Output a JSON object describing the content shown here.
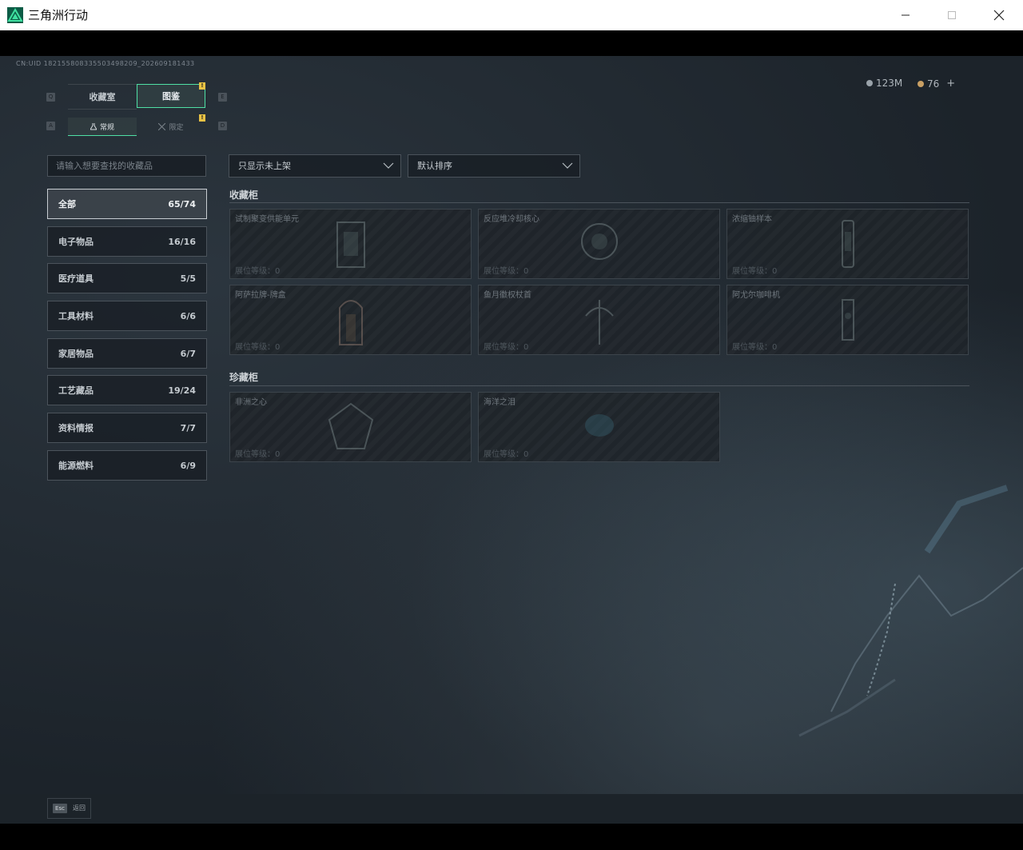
{
  "window": {
    "title": "三角洲行动",
    "icon": "delta-force-logo-icon",
    "controls": [
      "minimize-icon",
      "maximize-icon",
      "close-icon"
    ]
  },
  "header": {
    "uid": "CN:UID 18215580833550349820​9_202609181433",
    "currency_silver": "123M",
    "currency_gold": "76",
    "add_label": "+"
  },
  "tabs": {
    "left_key": "Q",
    "right_key": "E",
    "items": [
      {
        "label": "收藏室",
        "active": false
      },
      {
        "label": "图鉴",
        "active": true,
        "badge": "!"
      }
    ]
  },
  "subtabs": {
    "left_key": "A",
    "right_key": "D",
    "items": [
      {
        "label": "常规",
        "active": true,
        "icon": "flask-icon"
      },
      {
        "label": "限定",
        "active": false,
        "icon": "crossed-swords-icon",
        "badge": "!"
      }
    ]
  },
  "search": {
    "placeholder": "请输入想要查找的收藏品"
  },
  "categories": [
    {
      "label": "全部",
      "count": "65/74",
      "active": true
    },
    {
      "label": "电子物品",
      "count": "16/16"
    },
    {
      "label": "医疗道具",
      "count": "5/5"
    },
    {
      "label": "工具材料",
      "count": "6/6"
    },
    {
      "label": "家居物品",
      "count": "6/7"
    },
    {
      "label": "工艺藏品",
      "count": "19/24"
    },
    {
      "label": "资料情报",
      "count": "7/7"
    },
    {
      "label": "能源燃料",
      "count": "6/9"
    }
  ],
  "filters": {
    "show_filter": "只显示未上架",
    "sort": "默认排序"
  },
  "sections": [
    {
      "title": "收藏柜",
      "items": [
        {
          "name": "试制聚变供能单元",
          "level": "展位等级：0"
        },
        {
          "name": "反应堆冷却核心",
          "level": "展位等级：0"
        },
        {
          "name": "浓缩铀样本",
          "level": "展位等级：0"
        },
        {
          "name": "阿萨拉牌-牌盒",
          "level": "展位等级：0"
        },
        {
          "name": "鱼月徽权杖首",
          "level": "展位等级：0"
        },
        {
          "name": "阿尤尔咖啡机",
          "level": "展位等级：0"
        }
      ]
    },
    {
      "title": "珍藏柜",
      "items": [
        {
          "name": "非洲之心",
          "level": "展位等级：0"
        },
        {
          "name": "海洋之泪",
          "level": "展位等级：0"
        }
      ]
    }
  ],
  "footer": {
    "esc_key": "Esc",
    "back_label": "返回"
  }
}
